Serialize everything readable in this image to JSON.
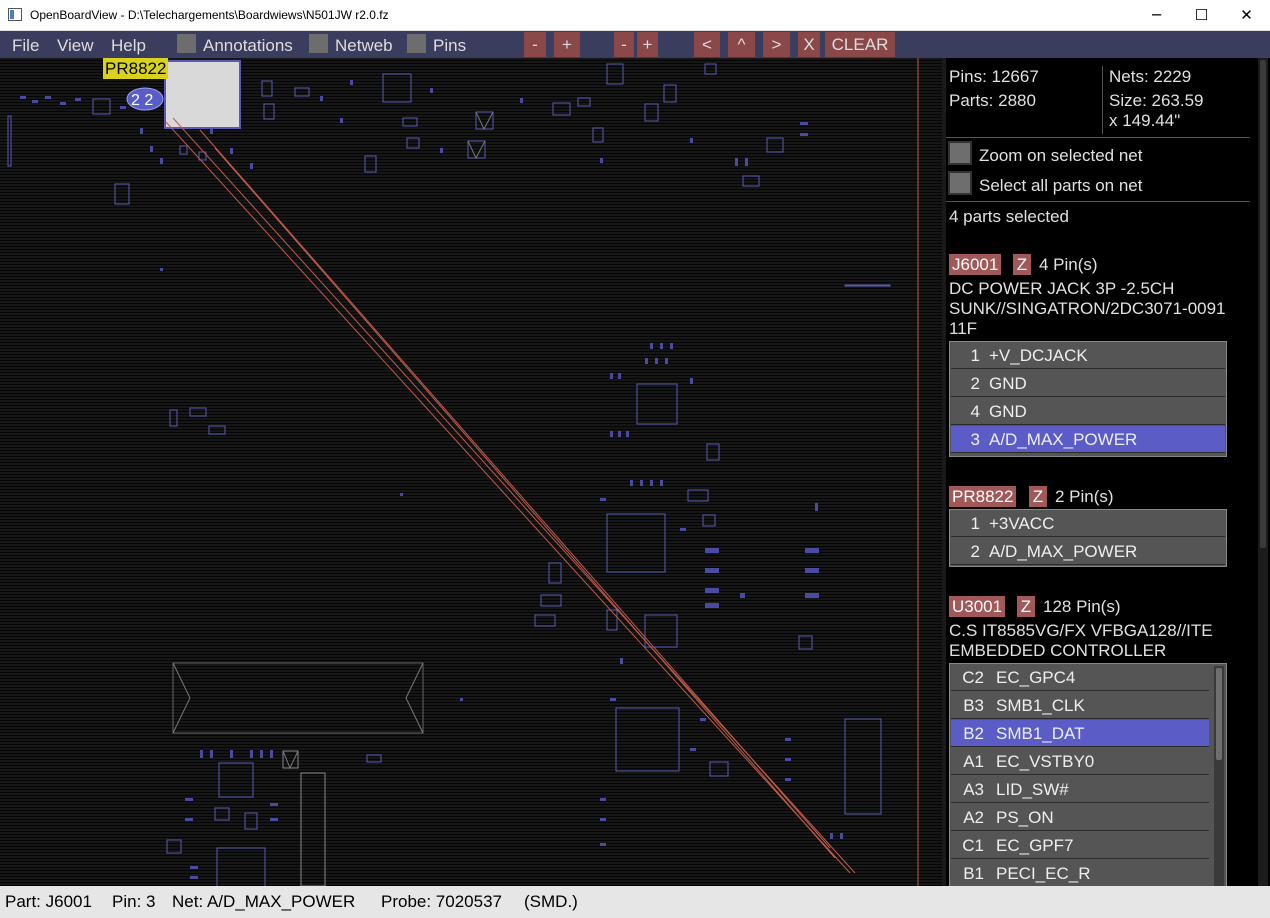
{
  "window": {
    "title": "OpenBoardView - D:\\Telechargements\\Boardwiews\\N501JW r2.0.fz",
    "minimize": "─",
    "maximize": "☐",
    "close": "✕"
  },
  "menu": {
    "file": "File",
    "view": "View",
    "help": "Help",
    "annotations": "Annotations",
    "netweb": "Netweb",
    "pins": "Pins",
    "zoom_out": "-",
    "zoom_in": "+",
    "size_down": "-",
    "size_up": "+",
    "prev": "<",
    "up": "^",
    "next": ">",
    "close_x": "X",
    "clear": "CLEAR"
  },
  "board": {
    "part_label": "PR8822",
    "pin_badge": "2 2"
  },
  "panel": {
    "pins": "Pins: 12667",
    "parts": "Parts: 2880",
    "nets": "Nets: 2229",
    "size_line1": "Size: 263.59",
    "size_line2": "x 149.44\"",
    "zoom_on_net": "Zoom on selected net",
    "select_all_on_net": "Select all parts on net",
    "selected_count": "4 parts selected",
    "parts_list": [
      {
        "name": "J6001",
        "z": "Z",
        "pin_count": "4 Pin(s)",
        "desc": [
          "DC POWER JACK 3P -2.5CH",
          "SUNK//SINGATRON/2DC3071-0091",
          "11F"
        ],
        "pins": [
          {
            "num": "1",
            "net": "+V_DCJACK"
          },
          {
            "num": "2",
            "net": "GND"
          },
          {
            "num": "4",
            "net": "GND"
          },
          {
            "num": "3",
            "net": "A/D_MAX_POWER"
          }
        ]
      },
      {
        "name": "PR8822",
        "z": "Z",
        "pin_count": "2 Pin(s)",
        "pins": [
          {
            "num": "1",
            "net": "+3VACC"
          },
          {
            "num": "2",
            "net": "A/D_MAX_POWER"
          }
        ]
      },
      {
        "name": "U3001",
        "z": "Z",
        "pin_count": "128 Pin(s)",
        "desc": [
          "C.S IT8585VG/FX VFBGA128//ITE",
          "EMBEDDED CONTROLLER"
        ],
        "pins": [
          {
            "num": "C2",
            "net": "EC_GPC4"
          },
          {
            "num": "B3",
            "net": "SMB1_CLK"
          },
          {
            "num": "B2",
            "net": "SMB1_DAT"
          },
          {
            "num": "A1",
            "net": "EC_VSTBY0"
          },
          {
            "num": "A3",
            "net": "LID_SW#"
          },
          {
            "num": "A2",
            "net": "PS_ON"
          },
          {
            "num": "C1",
            "net": "EC_GPF7"
          },
          {
            "num": "B1",
            "net": "PECI_EC_R"
          }
        ]
      }
    ]
  },
  "status": {
    "part": "Part: J6001",
    "pin": "Pin: 3",
    "net": "Net: A/D_MAX_POWER",
    "probe": "Probe: 7020537",
    "type": "(SMD.)"
  },
  "colors": {
    "menubar": "#3a3d5e",
    "button": "#8a4848",
    "part_tag": "#a05858",
    "selected_row": "#5b5cc5",
    "label_yellow": "#d8d21e",
    "net_line": "#c05a4a",
    "outline": "#5a5ab4"
  }
}
